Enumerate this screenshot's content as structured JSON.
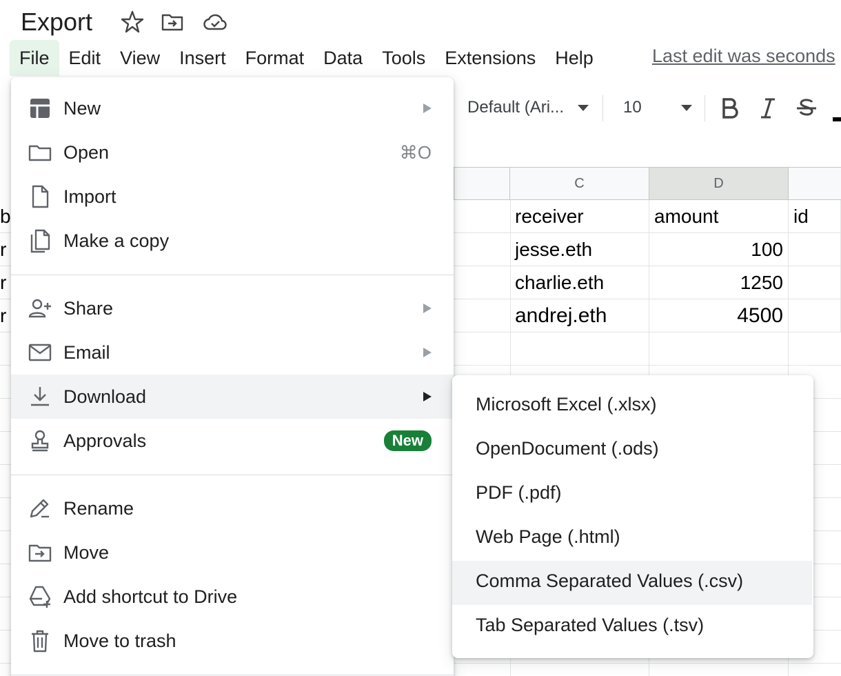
{
  "doc": {
    "title": "Export"
  },
  "menubar": {
    "items": [
      "File",
      "Edit",
      "View",
      "Insert",
      "Format",
      "Data",
      "Tools",
      "Extensions",
      "Help"
    ],
    "last_edit": "Last edit was seconds"
  },
  "toolbar": {
    "font": "Default (Ari...",
    "font_size": "10"
  },
  "sheet": {
    "columns": [
      "C",
      "D"
    ],
    "rows": [
      {
        "receiver": "receiver",
        "amount": "amount",
        "id": "id"
      },
      {
        "receiver": "jesse.eth",
        "amount": "100",
        "id": ""
      },
      {
        "receiver": "charlie.eth",
        "amount": "1250",
        "id": ""
      },
      {
        "receiver": "andrej.eth",
        "amount": "4500",
        "id": ""
      }
    ]
  },
  "file_menu": {
    "new": "New",
    "open": "Open",
    "open_shortcut": "⌘O",
    "import": "Import",
    "make_copy": "Make a copy",
    "share": "Share",
    "email": "Email",
    "download": "Download",
    "approvals": "Approvals",
    "approvals_badge": "New",
    "rename": "Rename",
    "move": "Move",
    "add_shortcut": "Add shortcut to Drive",
    "trash": "Move to trash"
  },
  "download_menu": {
    "items": [
      "Microsoft Excel (.xlsx)",
      "OpenDocument (.ods)",
      "PDF (.pdf)",
      "Web Page (.html)",
      "Comma Separated Values (.csv)",
      "Tab Separated Values (.tsv)"
    ]
  },
  "colors": {
    "accent_green": "#188038",
    "menu_active": "#e6f4ea",
    "highlight": "#f1f3f4"
  }
}
